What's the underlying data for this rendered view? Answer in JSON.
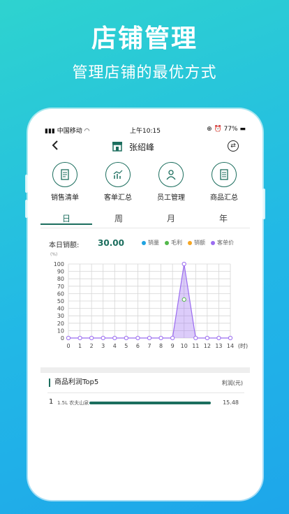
{
  "promo": {
    "title": "店铺管理",
    "subtitle": "管理店铺的最优方式"
  },
  "status_bar": {
    "carrier": "中国移动",
    "time": "上午10:15",
    "battery": "77%"
  },
  "nav": {
    "back_icon": "chevron-left-icon",
    "store_icon": "store-icon",
    "title": "张绍峰",
    "swap_icon": "swap-icon"
  },
  "menu": {
    "items": [
      {
        "label": "销售清单",
        "icon": "sales-list-icon"
      },
      {
        "label": "客单汇总",
        "icon": "customer-summary-icon"
      },
      {
        "label": "员工管理",
        "icon": "staff-icon"
      },
      {
        "label": "商品汇总",
        "icon": "product-summary-icon"
      }
    ]
  },
  "tabs": {
    "items": [
      "日",
      "周",
      "月",
      "年"
    ],
    "active_index": 0
  },
  "summary": {
    "label": "本日销额:",
    "value": "30.00"
  },
  "legend": {
    "items": [
      {
        "label": "销量",
        "color": "#1fa3e0"
      },
      {
        "label": "毛利",
        "color": "#52b84a"
      },
      {
        "label": "销额",
        "color": "#f5a623"
      },
      {
        "label": "客单价",
        "color": "#9b6cf0"
      }
    ]
  },
  "chart_data": {
    "type": "area",
    "unit_label": "(%)",
    "x_unit_label": "(时)",
    "x": [
      0,
      1,
      2,
      3,
      4,
      5,
      6,
      7,
      8,
      9,
      10,
      11,
      12,
      13,
      14
    ],
    "yticks": [
      0,
      10,
      20,
      30,
      40,
      50,
      60,
      70,
      80,
      90,
      100
    ],
    "ylim": [
      0,
      100
    ],
    "grid": true,
    "series": [
      {
        "name": "客单价",
        "color": "#9b6cf0",
        "values": [
          0,
          0,
          0,
          0,
          0,
          0,
          0,
          0,
          0,
          0,
          100,
          0,
          0,
          0,
          0
        ]
      },
      {
        "name": "毛利",
        "color": "#52b84a",
        "values": [
          0,
          0,
          0,
          0,
          0,
          0,
          0,
          0,
          0,
          0,
          52,
          0,
          0,
          0,
          0
        ]
      }
    ]
  },
  "top5": {
    "title": "商品利润Top5",
    "unit": "利润(元)",
    "rows": [
      {
        "rank": "1",
        "name": "1.5L 农夫山泉",
        "value": "15.48"
      }
    ]
  }
}
